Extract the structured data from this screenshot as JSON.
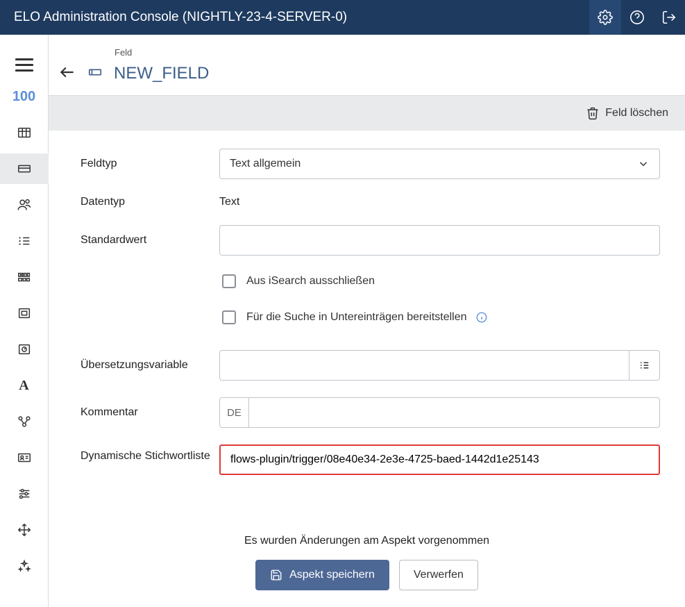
{
  "topbar": {
    "title": "ELO Administration Console (NIGHTLY-23-4-SERVER-0)"
  },
  "sidebar": {
    "counter": "100"
  },
  "header": {
    "crumb": "Feld",
    "title": "NEW_FIELD"
  },
  "toolbar": {
    "delete_label": "Feld löschen"
  },
  "form": {
    "fieldtype_label": "Feldtyp",
    "fieldtype_value": "Text allgemein",
    "datatype_label": "Datentyp",
    "datatype_value": "Text",
    "default_label": "Standardwert",
    "default_value": "",
    "exclude_isearch_label": "Aus iSearch ausschließen",
    "provide_subentries_label": "Für die Suche in Untereinträgen bereitstellen",
    "translation_label": "Übersetzungsvariable",
    "translation_value": "",
    "comment_label": "Kommentar",
    "comment_lang": "DE",
    "comment_value": "",
    "keywordlist_label": "Dynamische Stichwortliste",
    "keywordlist_value": "flows-plugin/trigger/08e40e34-2e3e-4725-baed-1442d1e25143"
  },
  "footer": {
    "changes_msg": "Es wurden Änderungen am Aspekt vorgenommen",
    "save_label": "Aspekt speichern",
    "discard_label": "Verwerfen"
  }
}
